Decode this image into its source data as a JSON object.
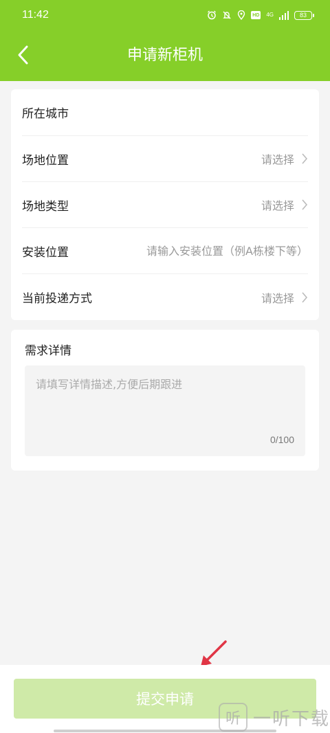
{
  "status_bar": {
    "time": "11:42",
    "signal_label": "4G",
    "battery": "83"
  },
  "header": {
    "title": "申请新柜机"
  },
  "form": {
    "city_label": "所在城市",
    "location_label": "场地位置",
    "location_value": "请选择",
    "type_label": "场地类型",
    "type_value": "请选择",
    "install_label": "安装位置",
    "install_placeholder": "请输入安装位置（例A栋楼下等）",
    "delivery_label": "当前投递方式",
    "delivery_value": "请选择"
  },
  "detail": {
    "title": "需求详情",
    "placeholder": "请填写详情描述,方便后期跟进",
    "count": "0/100"
  },
  "submit": {
    "label": "提交申请"
  },
  "watermark": {
    "logo": "听",
    "text": "一听下载"
  },
  "colors": {
    "brand": "#86cf29",
    "button_disabled": "#cfeaa8",
    "arrow": "#e03545"
  }
}
